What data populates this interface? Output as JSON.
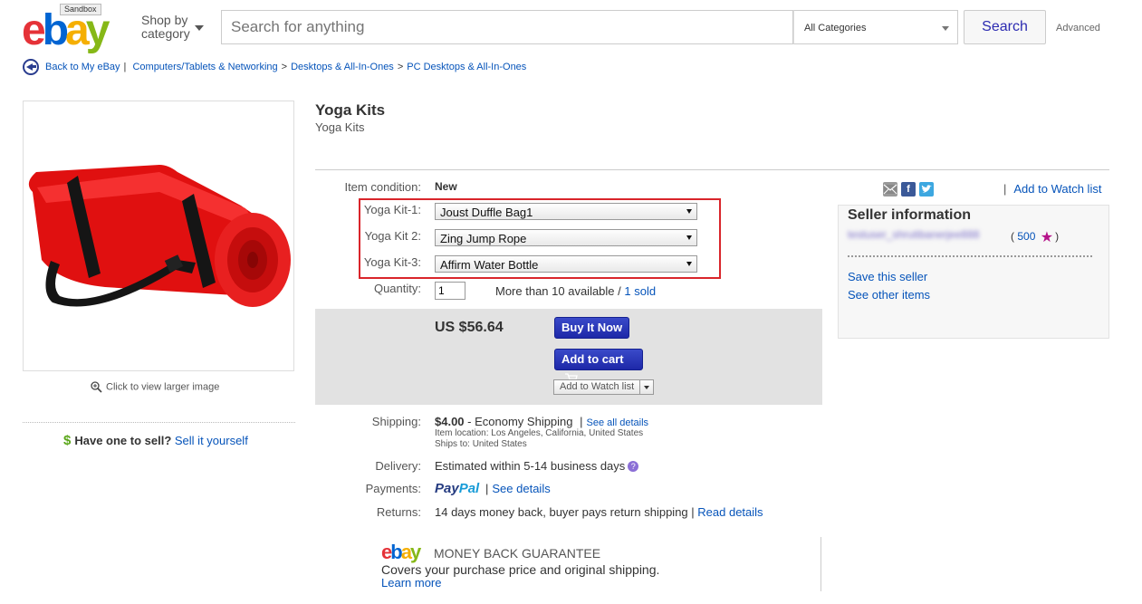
{
  "header": {
    "logo_letters": [
      "e",
      "b",
      "a",
      "y"
    ],
    "logo_colors": [
      "#e53238",
      "#0064d2",
      "#f5af02",
      "#86b817"
    ],
    "sandbox_label": "Sandbox",
    "shop_by_line1": "Shop by",
    "shop_by_line2": "category",
    "search_placeholder": "Search for anything",
    "category_select": "All Categories",
    "search_button": "Search",
    "advanced_link": "Advanced"
  },
  "breadcrumb": {
    "back_label": "Back to My eBay",
    "items": [
      "Computers/Tablets & Networking",
      "Desktops & All-In-Ones",
      "PC Desktops & All-In-Ones"
    ]
  },
  "image": {
    "zoom_label": "Click to view larger image"
  },
  "sell": {
    "question": "Have one to sell?",
    "link": "Sell it yourself"
  },
  "item": {
    "title": "Yoga Kits",
    "subtitle": "Yoga Kits",
    "condition_label": "Item condition:",
    "condition_value": "New",
    "variations": [
      {
        "label": "Yoga Kit-1:",
        "value": "Joust Duffle Bag1"
      },
      {
        "label": "Yoga Kit 2:",
        "value": "Zing Jump Rope"
      },
      {
        "label": "Yoga Kit-3:",
        "value": "Affirm Water Bottle"
      }
    ],
    "quantity_label": "Quantity:",
    "quantity_value": "1",
    "availability": "More than 10 available /",
    "sold": "1 sold"
  },
  "purchase": {
    "price": "US $56.64",
    "buy_now": "Buy It Now",
    "add_to_cart": "Add to cart",
    "add_to_watch": "Add to Watch list"
  },
  "shipping": {
    "label": "Shipping:",
    "cost": "$4.00",
    "method": "- Economy Shipping",
    "see_all": "See all details",
    "location": "Item location: Los Angeles, California, United States",
    "ships_to": "Ships to: United States"
  },
  "delivery": {
    "label": "Delivery:",
    "value": "Estimated within 5-14 business days"
  },
  "payments": {
    "label": "Payments:",
    "paypal_1": "Pay",
    "paypal_2": "Pal",
    "see_details": "See details"
  },
  "returns": {
    "label": "Returns:",
    "value": "14 days money back, buyer pays return shipping |",
    "read_details": "Read details"
  },
  "guarantee": {
    "title": "MONEY BACK GUARANTEE",
    "text": "Covers your purchase price and original shipping.",
    "learn_more": "Learn more"
  },
  "seller": {
    "watch_link": "Add to Watch list",
    "title": "Seller information",
    "name": "testuser_shrutibanerjee888",
    "score": "500",
    "save": "Save this seller",
    "other": "See other items"
  }
}
